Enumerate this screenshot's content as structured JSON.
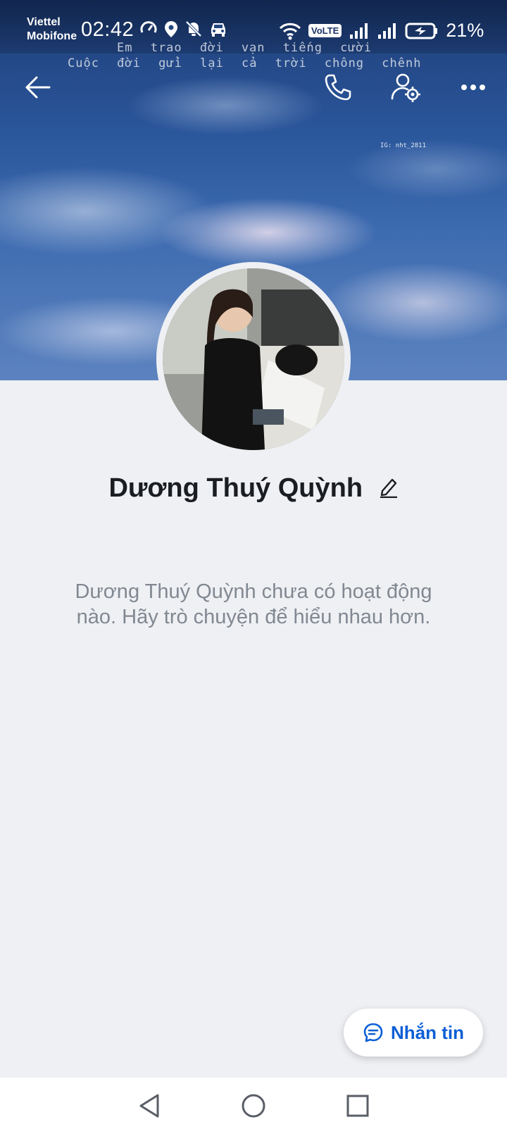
{
  "status_bar": {
    "carrier_line1": "Viettel",
    "carrier_line2": "Mobifone",
    "time": "02:42",
    "network": "VoLTE",
    "battery": "21%"
  },
  "cover": {
    "lyrics_line1": "Em trao đời vạn tiếng cười",
    "lyrics_line2": "Cuộc đời gửi lại cả trời chông chênh",
    "tag": "IG: nht_2811"
  },
  "header": {
    "back_icon": "arrow-left-icon",
    "call_icon": "phone-icon",
    "settings_icon": "user-settings-icon",
    "more_icon": "more-dots-icon"
  },
  "profile": {
    "name": "Dương Thuý Quỳnh",
    "empty_activity": "Dương Thuý Quỳnh chưa có hoạt động nào. Hãy trò chuyện để hiểu nhau hơn."
  },
  "message_button": {
    "label": "Nhắn tin",
    "color": "#0c5fd6"
  },
  "nav_bar": {
    "back": "triangle-back-icon",
    "home": "circle-home-icon",
    "recents": "square-recents-icon"
  }
}
